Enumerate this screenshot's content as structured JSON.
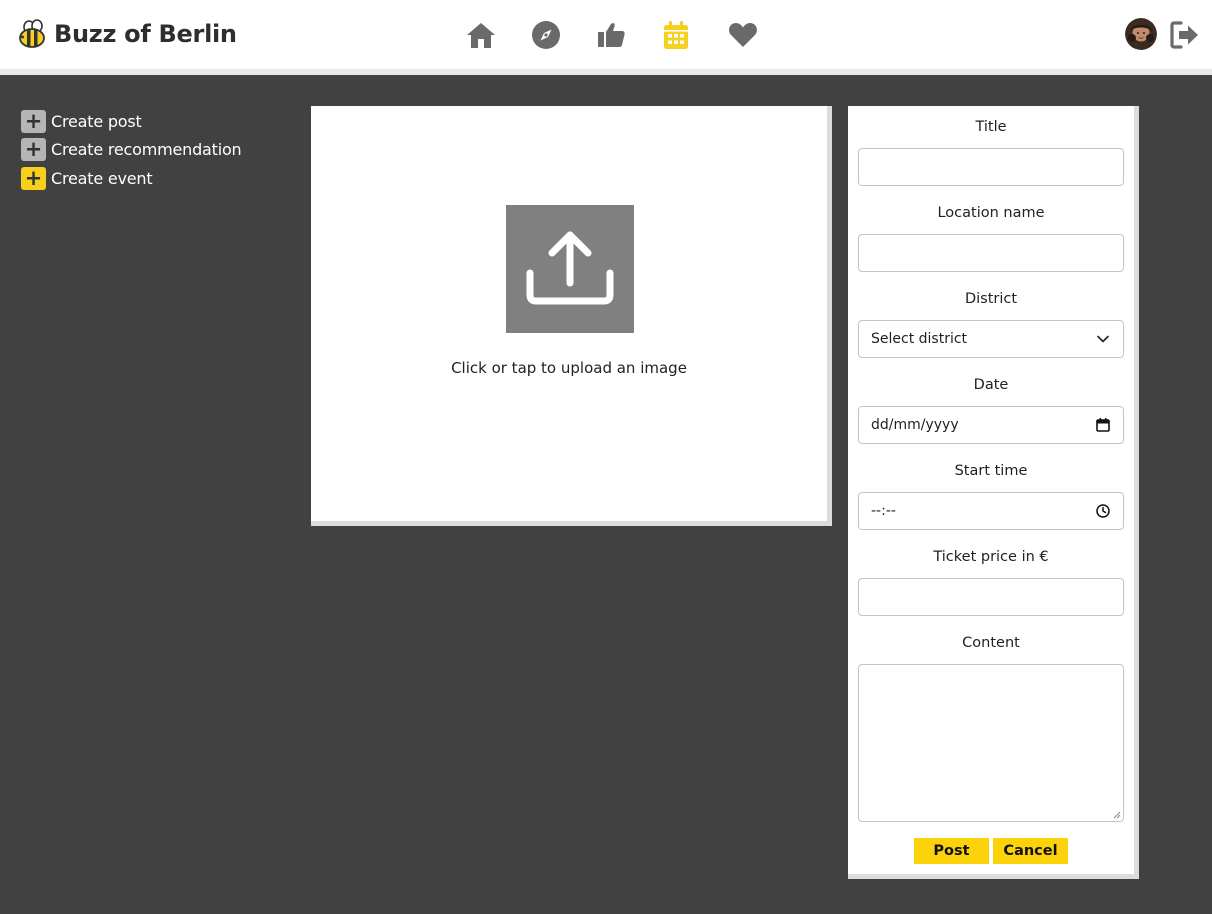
{
  "app": {
    "title": "Buzz of Berlin",
    "accent_color": "#f7cf1d",
    "background_color": "#414141"
  },
  "nav": [
    {
      "name": "home",
      "icon": "home-icon",
      "active": false
    },
    {
      "name": "explore",
      "icon": "compass-icon",
      "active": false
    },
    {
      "name": "recommendations",
      "icon": "thumbs-up-icon",
      "active": false
    },
    {
      "name": "events",
      "icon": "calendar-icon",
      "active": true
    },
    {
      "name": "favorites",
      "icon": "heart-icon",
      "active": false
    }
  ],
  "user": {
    "avatar_icon": "avatar-icon",
    "logout_icon": "logout-icon"
  },
  "sidebar": {
    "items": [
      {
        "plus": "+",
        "label": "Create post",
        "active": false
      },
      {
        "plus": "+",
        "label": "Create recommendation",
        "active": false
      },
      {
        "plus": "+",
        "label": "Create event",
        "active": true
      }
    ]
  },
  "upload": {
    "icon": "upload-icon",
    "text": "Click or tap to upload an image"
  },
  "form": {
    "title_label": "Title",
    "title_value": "",
    "location_label": "Location name",
    "location_value": "",
    "district_label": "District",
    "district_selected": "Select district",
    "date_label": "Date",
    "date_placeholder": "dd/mm/yyyy",
    "start_time_label": "Start time",
    "start_time_placeholder": "--:--",
    "ticket_label": "Ticket price in €",
    "ticket_value": "",
    "content_label": "Content",
    "content_value": "",
    "post_button": "Post",
    "cancel_button": "Cancel"
  }
}
